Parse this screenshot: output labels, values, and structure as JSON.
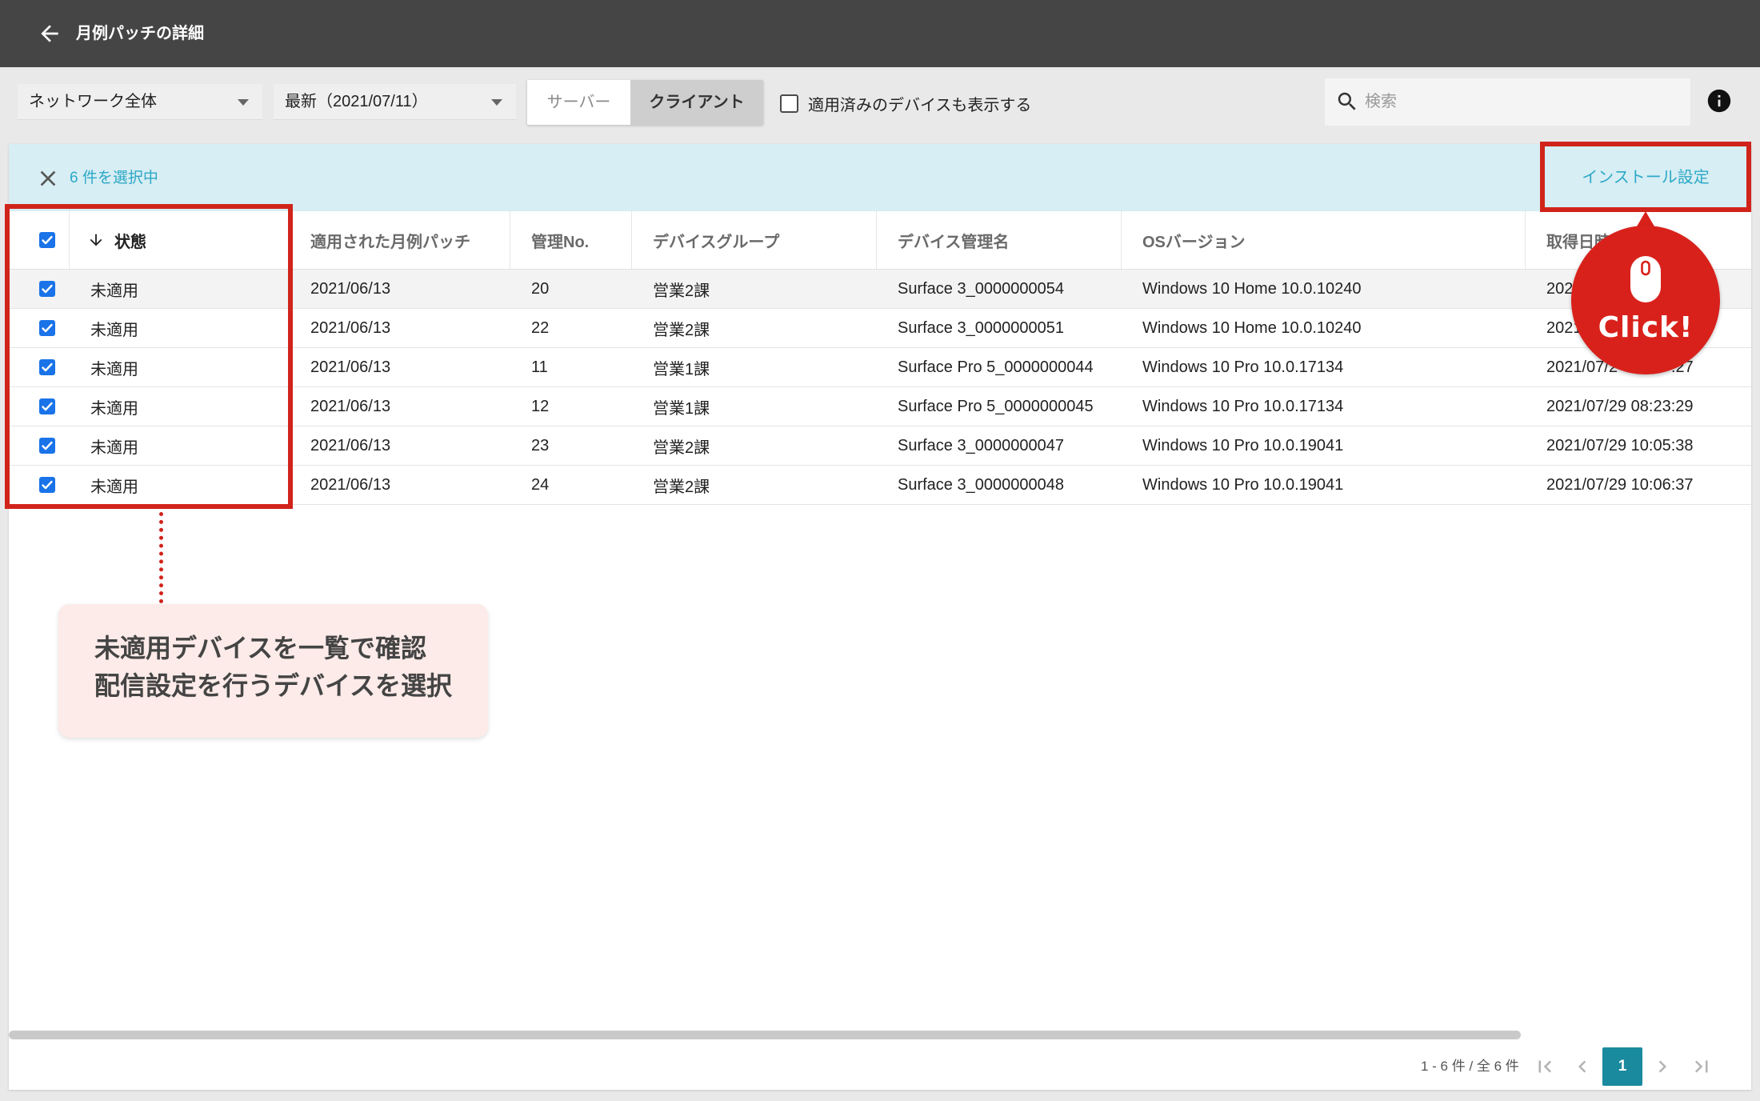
{
  "header": {
    "title": "月例パッチの詳細",
    "back_icon": "arrow-left-icon"
  },
  "toolbar": {
    "network_select": "ネットワーク全体",
    "version_select": "最新（2021/07/11）",
    "toggle": {
      "server": "サーバー",
      "client": "クライアント",
      "server_selected": false,
      "client_selected": true
    },
    "show_applied_label": "適用済みのデバイスも表示する",
    "show_applied_checked": false,
    "search_placeholder": "検索",
    "search_icon": "search-icon",
    "info_icon": "info-icon"
  },
  "selection_bar": {
    "close_icon": "close-icon",
    "count_label": "6 件を選択中",
    "install_settings_label": "インストール設定"
  },
  "table": {
    "all_selected": true,
    "sort_icon": "arrow-down-icon",
    "columns": {
      "status": "状態",
      "patch": "適用された月例パッチ",
      "no": "管理No.",
      "group": "デバイスグループ",
      "device": "デバイス管理名",
      "os": "OSバージョン",
      "acquired": "取得日時"
    },
    "rows": [
      {
        "checked": true,
        "status": "未適用",
        "patch": "2021/06/13",
        "no": "20",
        "group": "営業2課",
        "device": "Surface 3_0000000054",
        "os": "Windows 10 Home 10.0.10240",
        "acquired": "202"
      },
      {
        "checked": true,
        "status": "未適用",
        "patch": "2021/06/13",
        "no": "22",
        "group": "営業2課",
        "device": "Surface 3_0000000051",
        "os": "Windows 10 Home 10.0.10240",
        "acquired": "2021"
      },
      {
        "checked": true,
        "status": "未適用",
        "patch": "2021/06/13",
        "no": "11",
        "group": "営業1課",
        "device": "Surface Pro 5_0000000044",
        "os": "Windows 10 Pro 10.0.17134",
        "acquired": "2021/07/2",
        "acquired_tail": ":27"
      },
      {
        "checked": true,
        "status": "未適用",
        "patch": "2021/06/13",
        "no": "12",
        "group": "営業1課",
        "device": "Surface Pro 5_0000000045",
        "os": "Windows 10 Pro 10.0.17134",
        "acquired": "2021/07/29 08:23:29"
      },
      {
        "checked": true,
        "status": "未適用",
        "patch": "2021/06/13",
        "no": "23",
        "group": "営業2課",
        "device": "Surface 3_0000000047",
        "os": "Windows 10 Pro 10.0.19041",
        "acquired": "2021/07/29 10:05:38"
      },
      {
        "checked": true,
        "status": "未適用",
        "patch": "2021/06/13",
        "no": "24",
        "group": "営業2課",
        "device": "Surface 3_0000000048",
        "os": "Windows 10 Pro 10.0.19041",
        "acquired": "2021/07/29 10:06:37"
      }
    ]
  },
  "pagination": {
    "range_label": "1 - 6 件 / 全 6 件",
    "current_page": "1",
    "icons": [
      "first-page-icon",
      "chevron-left-icon",
      "chevron-right-icon",
      "last-page-icon"
    ]
  },
  "annotation": {
    "callout_line_1": "未適用デバイスを一覧で確認",
    "callout_line_2": "配信設定を行うデバイスを選択",
    "click_label": "Click!",
    "mouse_icon": "mouse-icon"
  },
  "colors": {
    "header_bg": "#454545",
    "accent_teal": "#2ea8c6",
    "selection_bar_bg": "#d6eef4",
    "checkbox_blue": "#1a73e8",
    "page_button": "#1a8a9f",
    "highlight_red": "#d0241b",
    "callout_bg": "#fcebe8"
  }
}
